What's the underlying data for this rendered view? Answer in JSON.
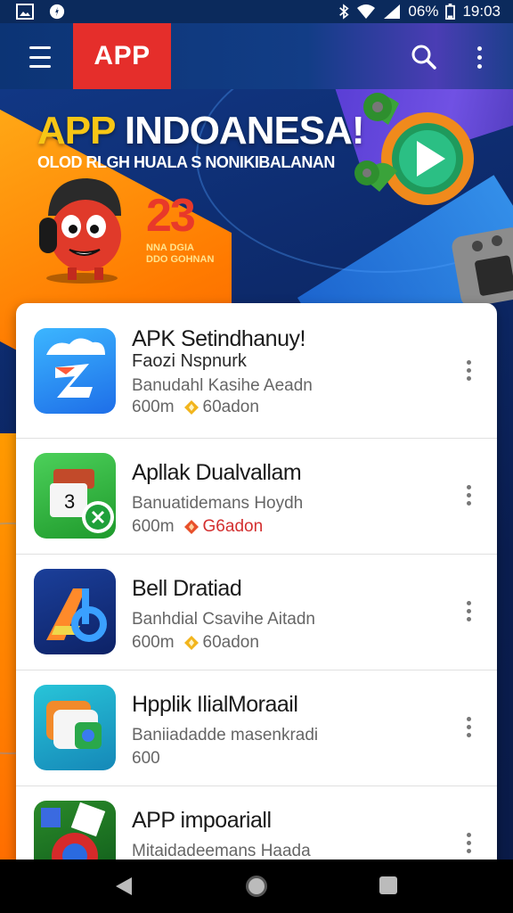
{
  "status_bar": {
    "battery": "06%",
    "time": "19:03"
  },
  "app_bar": {
    "logo": "APP"
  },
  "banner": {
    "title_part1": "APP",
    "title_part2": " INDOANESA!",
    "subtitle": "OLOD RLGH HUALA S NONIKIBALANAN",
    "number": "23",
    "small_line1": "NNA DGIA",
    "small_line2": "DDO GOHNAN"
  },
  "apps": [
    {
      "title": "APK Setindhanuy!",
      "subtitle": "Faozi Nspnurk",
      "desc": "Banudahl Kasihe Aeadn",
      "size": "600m",
      "downloads": "60adon",
      "downloads_color": "normal"
    },
    {
      "title": "Apllak Dualvallam",
      "subtitle": "",
      "desc": "Banuatidemans Hoydh",
      "size": "600m",
      "downloads": "G6adon",
      "downloads_color": "red"
    },
    {
      "title": "Bell Dratiad",
      "subtitle": "",
      "desc": "Banhdial Csavihe Aitadn",
      "size": "600m",
      "downloads": "60adon",
      "downloads_color": "normal"
    },
    {
      "title": "Hpplik IlialMoraail",
      "subtitle": "",
      "desc": "Baniiadadde masenkradi",
      "size": "600",
      "downloads": "",
      "downloads_color": "normal"
    },
    {
      "title": "APP impoariall",
      "subtitle": "",
      "desc": "Mitaidadeemans Haada",
      "size": "",
      "downloads": "",
      "downloads_color": "normal"
    }
  ],
  "icons": {
    "menu": "menu-icon",
    "search": "search-icon",
    "more": "more-vert-icon",
    "download_badge": "diamond-icon",
    "nav_back": "back-triangle-icon",
    "nav_home": "home-circle-icon",
    "nav_recent": "recent-square-icon"
  },
  "colors": {
    "logo_bg": "#e52e2b",
    "title_highlight": "#f7c615",
    "number": "#e8392a",
    "download_red": "#d32f2f"
  }
}
